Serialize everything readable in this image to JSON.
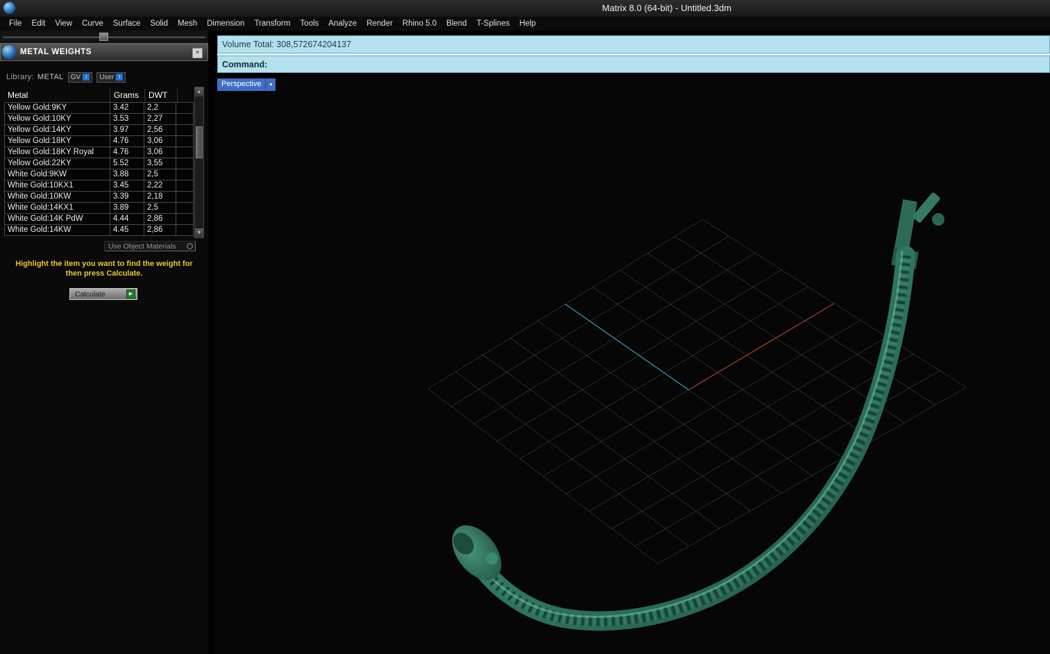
{
  "window": {
    "title": "Matrix 8.0 (64-bit) - Untitled.3dm"
  },
  "menu": {
    "items": [
      "File",
      "Edit",
      "View",
      "Curve",
      "Surface",
      "Solid",
      "Mesh",
      "Dimension",
      "Transform",
      "Tools",
      "Analyze",
      "Render",
      "Rhino 5.0",
      "Blend",
      "T-Splines",
      "Help"
    ]
  },
  "panel": {
    "title": "METAL WEIGHTS",
    "close_glyph": "✕",
    "library_label": "Library:",
    "library_value": "METAL",
    "gv_button": "GV",
    "user_button": "User",
    "toggle_glyph": "I",
    "table": {
      "headers": {
        "metal": "Metal",
        "grams": "Grams",
        "dwt": "DWT"
      },
      "rows": [
        {
          "metal": "Yellow Gold:9KY",
          "grams": "3.42",
          "dwt": "2,2"
        },
        {
          "metal": "Yellow Gold:10KY",
          "grams": "3.53",
          "dwt": "2,27"
        },
        {
          "metal": "Yellow Gold:14KY",
          "grams": "3.97",
          "dwt": "2,56"
        },
        {
          "metal": "Yellow Gold:18KY",
          "grams": "4.76",
          "dwt": "3,06"
        },
        {
          "metal": "Yellow Gold:18KY Royal",
          "grams": "4.76",
          "dwt": "3,06"
        },
        {
          "metal": "Yellow Gold:22KY",
          "grams": "5.52",
          "dwt": "3,55"
        },
        {
          "metal": "White Gold:9KW",
          "grams": "3.88",
          "dwt": "2,5"
        },
        {
          "metal": "White Gold:10KX1",
          "grams": "3.45",
          "dwt": "2,22"
        },
        {
          "metal": "White Gold:10KW",
          "grams": "3.39",
          "dwt": "2,18"
        },
        {
          "metal": "White Gold:14KX1",
          "grams": "3.89",
          "dwt": "2,5"
        },
        {
          "metal": "White Gold:14K PdW",
          "grams": "4.44",
          "dwt": "2,86"
        },
        {
          "metal": "White Gold:14KW",
          "grams": "4.45",
          "dwt": "2,86"
        }
      ]
    },
    "use_object_materials": "Use Object Materials",
    "instruction": "Highlight the item you want to find the weight for then press Calculate.",
    "calculate_label": "Calculate",
    "calculate_glyph": "▶"
  },
  "command": {
    "volume_label": "Volume Total: ",
    "volume_value": "308,572674204137",
    "command_label": "Command:"
  },
  "viewport": {
    "label": "Perspective",
    "dropdown_glyph": "▼",
    "colors": {
      "x_axis": "#a53c32",
      "y_axis": "#3e93b4",
      "grid": "#8a9094",
      "model": "#2f7460",
      "model_light": "#55a688",
      "model_dark": "#163f34"
    }
  },
  "scrollbar": {
    "up_glyph": "▲",
    "down_glyph": "▼"
  }
}
